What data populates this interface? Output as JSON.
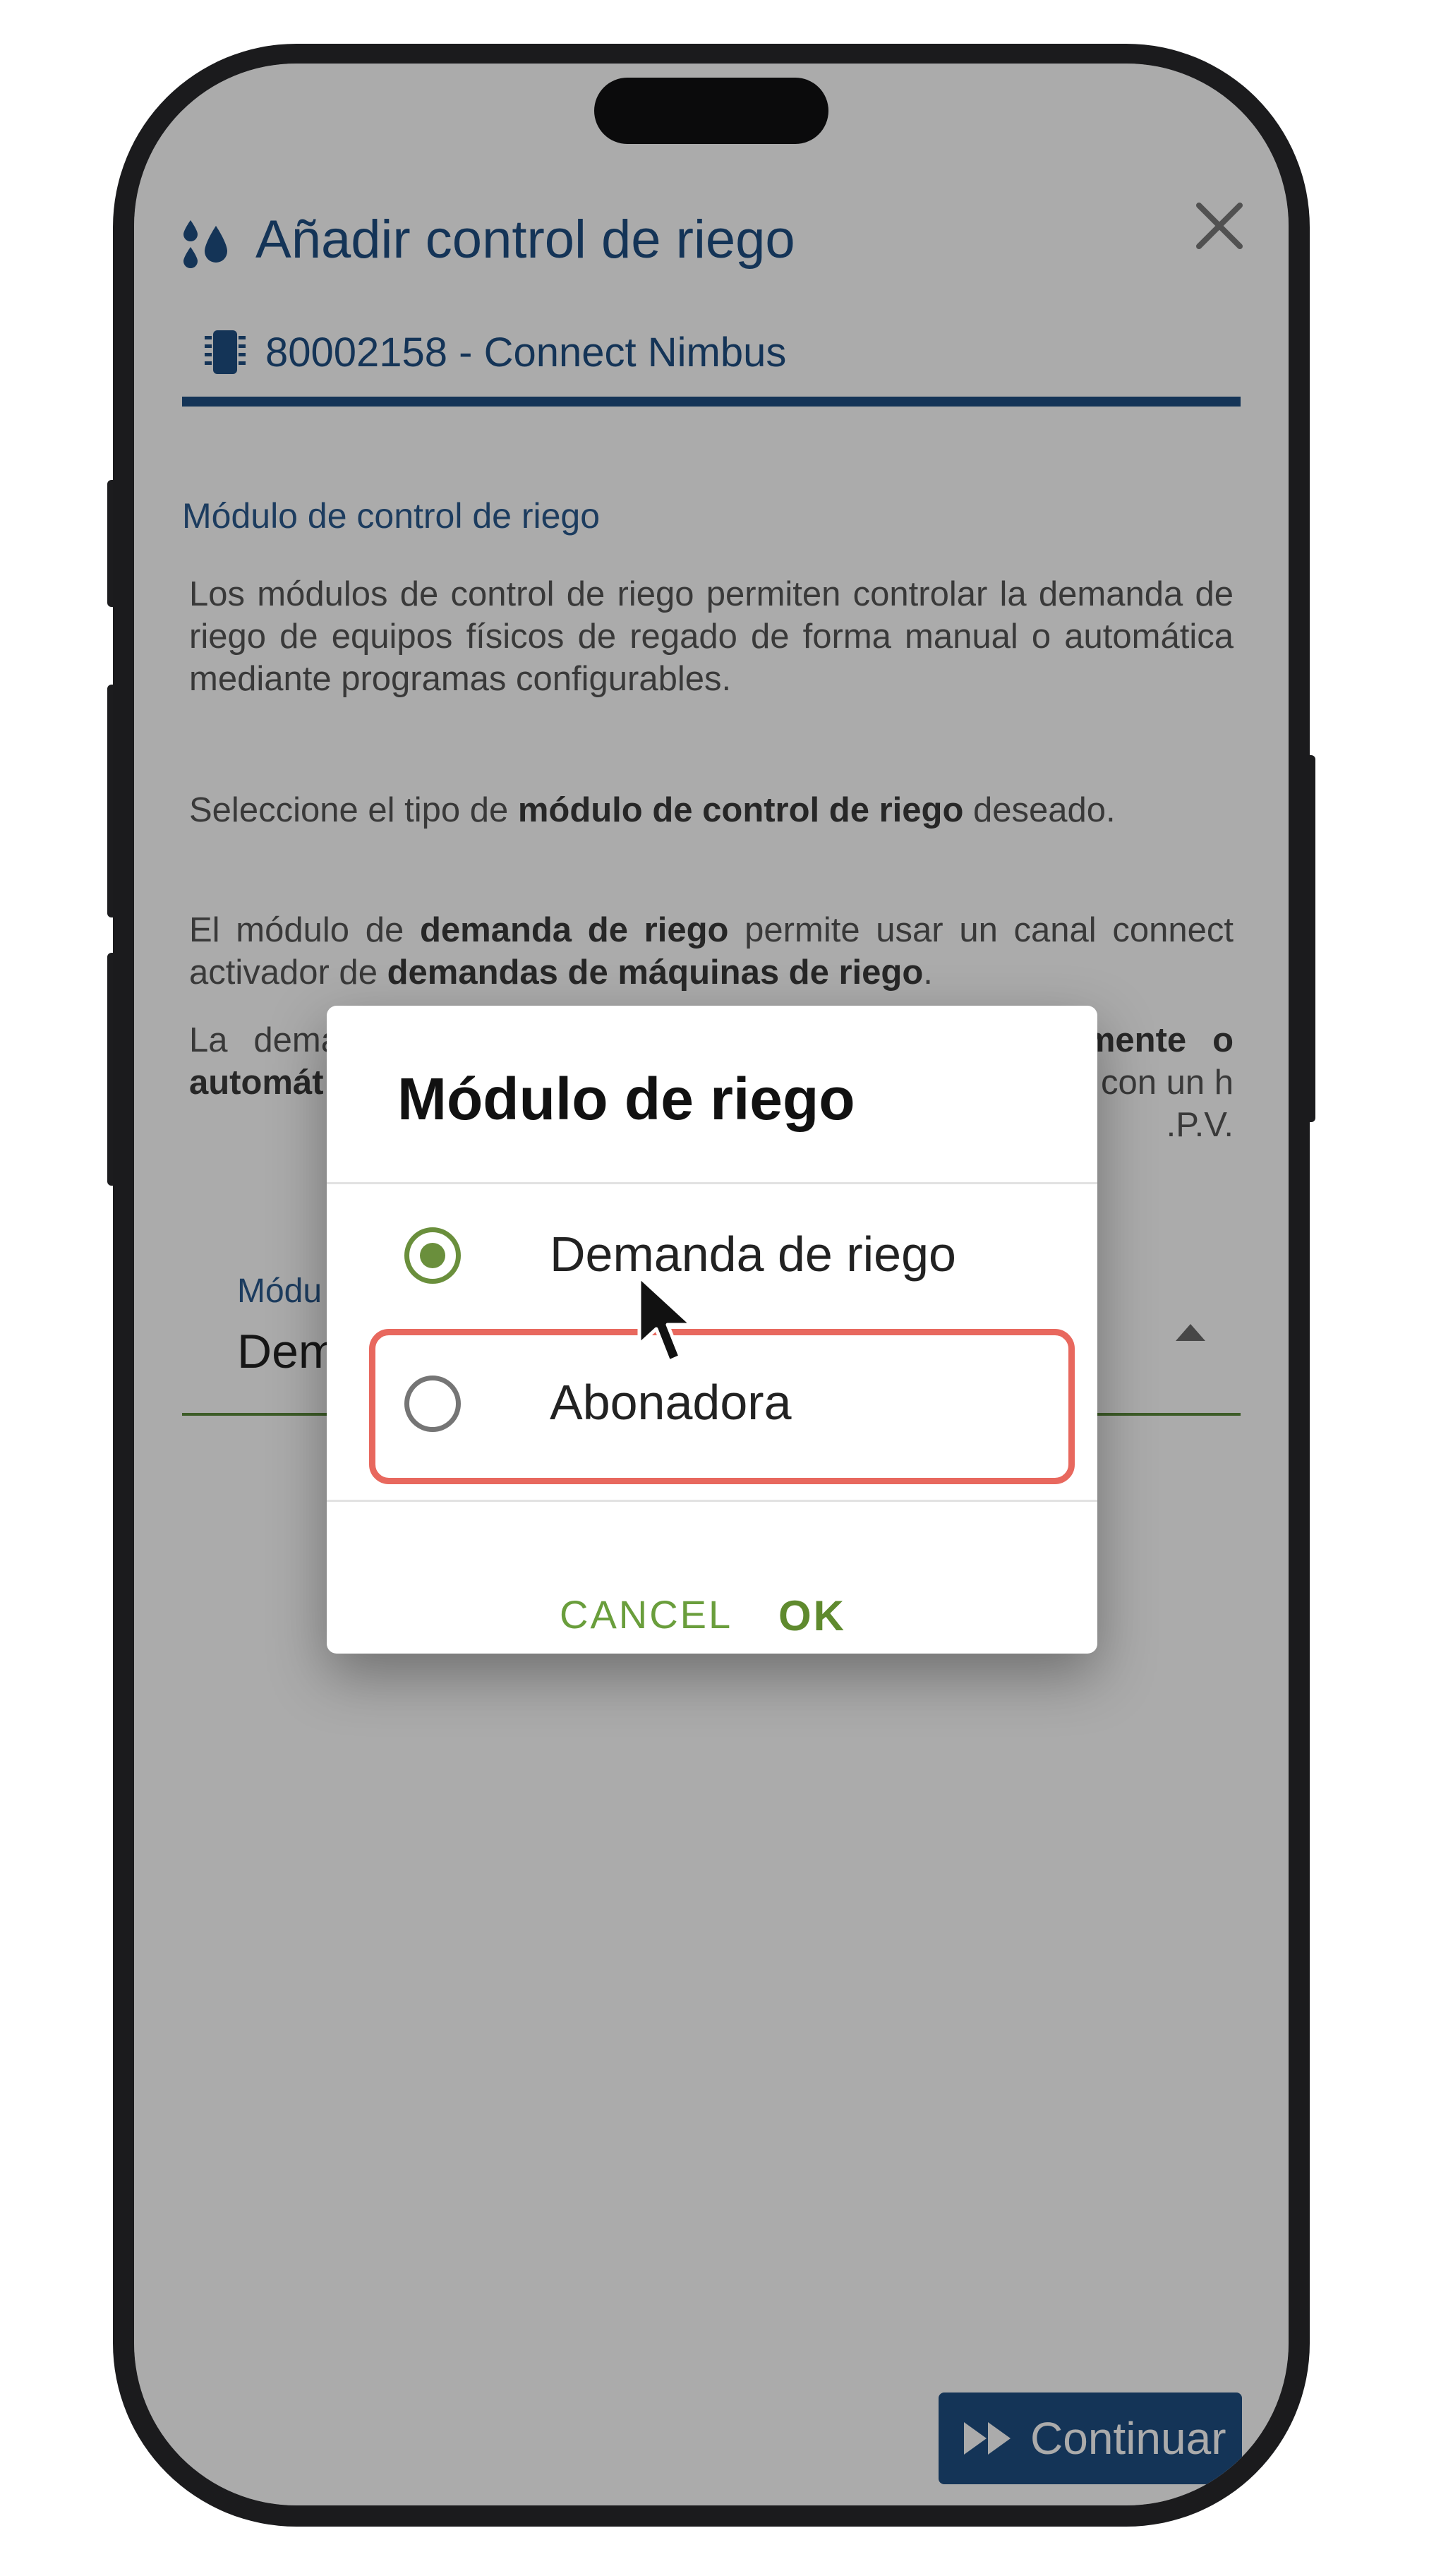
{
  "header": {
    "title": "Añadir control de riego",
    "device": "80002158 - Connect Nimbus"
  },
  "content": {
    "section_title": "Módulo de control de riego",
    "intro": "Los módulos de control de riego permiten controlar la demanda de riego de equipos físicos de regado de forma manual o automática mediante programas configurables.",
    "select_prompt": {
      "before": "Seleccione el tipo de ",
      "bold": "módulo de control de riego",
      "after": " deseado."
    },
    "demand_desc": {
      "p1": "El módulo de ",
      "b1": "demanda de riego",
      "p2": " permite usar un canal connect activador de ",
      "b2": "demandas de máquinas de riego",
      "p3": "."
    },
    "activation_desc": {
      "p1": "La demanda se puede activar y desactivar ",
      "b1": "manualmente o automát",
      "p2": "gurables con un h",
      "p3": ".P.V."
    }
  },
  "select": {
    "label": "Módu",
    "value": "Dem"
  },
  "dialog": {
    "title": "Módulo de riego",
    "options": [
      {
        "label": "Demanda de riego",
        "checked": true
      },
      {
        "label": "Abonadora",
        "checked": false
      }
    ],
    "cancel": "CANCEL",
    "ok": "OK"
  },
  "footer": {
    "continue": "Continuar"
  },
  "colors": {
    "brand_blue": "#1f4e82",
    "accent_green": "#6a8f3c",
    "highlight": "#e8685e"
  },
  "icons": {
    "header": "water-drops-icon",
    "device": "chip-icon",
    "close": "close-icon",
    "continue": "fast-forward-icon"
  }
}
